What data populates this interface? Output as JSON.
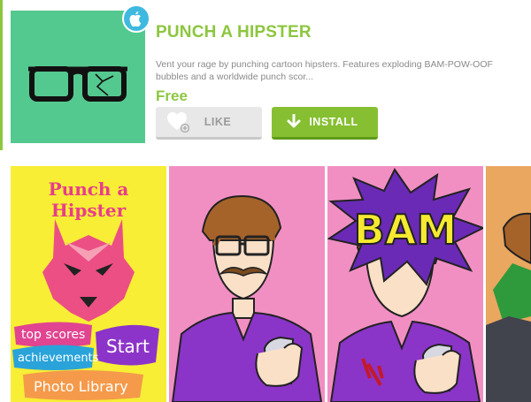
{
  "app": {
    "title": "PUNCH A HIPSTER",
    "description": "Vent your rage by punching cartoon hipsters. Features exploding BAM-POW-OOF bubbles and a worldwide punch scor...",
    "price": "Free",
    "icon": "glasses-icon",
    "platform_badge": "apple-icon"
  },
  "actions": {
    "like_label": "LIKE",
    "install_label": "INSTALL"
  },
  "screenshots": {
    "shot1": {
      "title": "Punch a Hipster",
      "menu": [
        "top scores",
        "Start",
        "achievements",
        "Photo Library"
      ]
    },
    "shot3": {
      "burst_text": "BAM"
    }
  },
  "colors": {
    "brand_green": "#8dc63f",
    "icon_bg": "#54c98f",
    "install_bg": "#86bf31",
    "like_bg": "#e8e8e8",
    "badge_bg": "#3fb9e0"
  }
}
